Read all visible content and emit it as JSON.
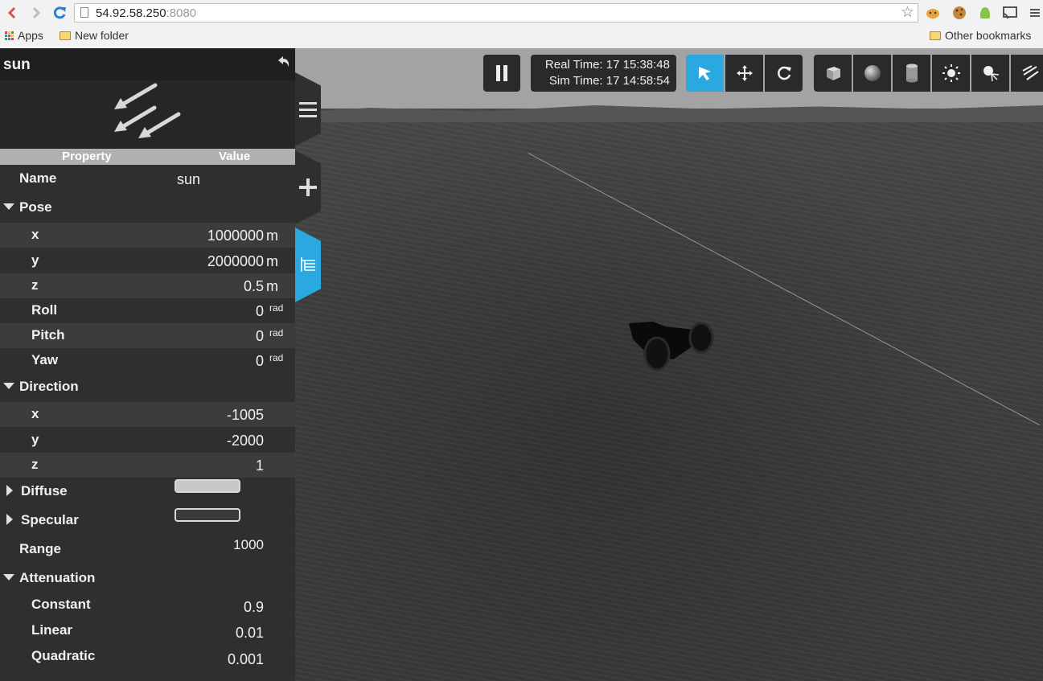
{
  "browser": {
    "url_host": "54.92.58.250",
    "url_port": ":8080",
    "bookmarks": {
      "apps": "Apps",
      "new_folder": "New folder",
      "other": "Other bookmarks"
    }
  },
  "toolbar": {
    "real_time": "Real Time: 17 15:38:48",
    "sim_time": "Sim Time: 17 14:58:54",
    "modes": [
      "select-icon",
      "translate-icon",
      "rotate-icon"
    ],
    "active_mode": "select-icon",
    "shapes": [
      "box-icon",
      "sphere-icon",
      "cylinder-icon",
      "point-light-icon",
      "spot-light-icon",
      "directional-light-icon"
    ]
  },
  "panel": {
    "title": "sun",
    "col_property": "Property",
    "col_value": "Value",
    "name_label": "Name",
    "name_value": "sun",
    "pose": {
      "label": "Pose",
      "x": {
        "label": "x",
        "value": "1000000",
        "unit": "m"
      },
      "y": {
        "label": "y",
        "value": "2000000",
        "unit": "m"
      },
      "z": {
        "label": "z",
        "value": "0.5",
        "unit": "m"
      },
      "roll": {
        "label": "Roll",
        "value": "0",
        "unit": "rad"
      },
      "pitch": {
        "label": "Pitch",
        "value": "0",
        "unit": "rad"
      },
      "yaw": {
        "label": "Yaw",
        "value": "0",
        "unit": "rad"
      }
    },
    "direction": {
      "label": "Direction",
      "x": {
        "label": "x",
        "value": "-1005"
      },
      "y": {
        "label": "y",
        "value": "-2000"
      },
      "z": {
        "label": "z",
        "value": "1"
      }
    },
    "diffuse_label": "Diffuse",
    "diffuse_color": "#c8c8c8",
    "specular_label": "Specular",
    "specular_color": "#3a3a3a",
    "range_label": "Range",
    "range_value": "1000",
    "attenuation": {
      "label": "Attenuation",
      "constant": {
        "label": "Constant",
        "value": "0.9"
      },
      "linear": {
        "label": "Linear",
        "value": "0.01"
      },
      "quadratic": {
        "label": "Quadratic",
        "value": "0.001"
      }
    }
  }
}
